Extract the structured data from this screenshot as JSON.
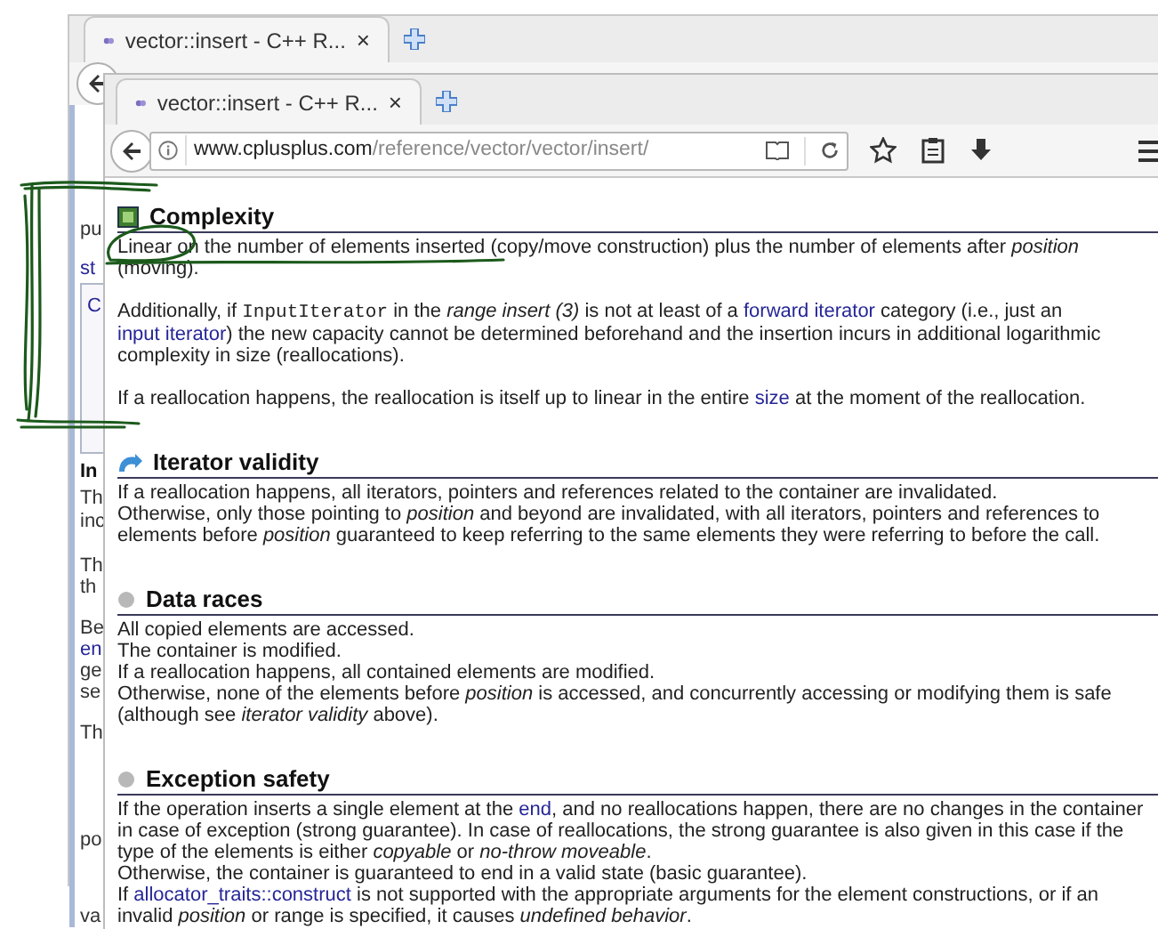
{
  "back_window": {
    "tab": {
      "title": "vector::insert - C++ R...",
      "close": "×",
      "selected": true
    },
    "fragments": [
      {
        "kind": "text",
        "text": "pu"
      },
      {
        "kind": "link",
        "text": "st"
      },
      {
        "kind": "box",
        "text": "C"
      },
      {
        "kind": "bold",
        "text": "In"
      },
      {
        "kind": "text",
        "text": "Th"
      },
      {
        "kind": "text",
        "text": "inc"
      },
      {
        "kind": "text",
        "text": "Th"
      },
      {
        "kind": "text",
        "text": "th"
      },
      {
        "kind": "text",
        "text": "Be"
      },
      {
        "kind": "link",
        "text": "en"
      },
      {
        "kind": "text",
        "text": "ge"
      },
      {
        "kind": "text",
        "text": "se"
      },
      {
        "kind": "text",
        "text": "Th"
      },
      {
        "kind": "text",
        "text": "po"
      },
      {
        "kind": "text",
        "text": "va"
      }
    ]
  },
  "front_window": {
    "tab": {
      "title": "vector::insert - C++ R...",
      "close": "×",
      "selected": true
    },
    "url": {
      "domain": "www.cplusplus.com",
      "path": "/reference/vector/vector/insert/"
    },
    "sections": [
      {
        "title": "Complexity",
        "blocks": [
          [
            [
              {
                "kind": "plain",
                "text": "Linear on the number of elements inserted (copy/move construction) plus the number of elements after "
              },
              {
                "kind": "italic",
                "text": "position"
              },
              {
                "kind": "plain",
                "text": " (moving)."
              }
            ]
          ],
          [
            [
              {
                "kind": "plain",
                "text": "Additionally, if "
              },
              {
                "kind": "code",
                "text": "InputIterator"
              },
              {
                "kind": "plain",
                "text": " in the "
              },
              {
                "kind": "italic",
                "text": "range insert (3)"
              },
              {
                "kind": "plain",
                "text": " is not at least of a "
              },
              {
                "kind": "link",
                "text": "forward iterator"
              },
              {
                "kind": "plain",
                "text": " category (i.e., just an "
              },
              {
                "kind": "link",
                "text": "input iterator"
              },
              {
                "kind": "plain",
                "text": ") the new capacity cannot be determined beforehand and the insertion incurs in additional logarithmic complexity in size (reallocations)."
              }
            ]
          ],
          [
            [
              {
                "kind": "plain",
                "text": "If a reallocation happens, the reallocation is itself up to linear in the entire "
              },
              {
                "kind": "link",
                "text": "size"
              },
              {
                "kind": "plain",
                "text": " at the moment of the reallocation."
              }
            ]
          ]
        ]
      },
      {
        "title": "Iterator validity",
        "blocks": [
          [
            [
              {
                "kind": "plain",
                "text": "If a reallocation happens, all iterators, pointers and references related to the container are invalidated."
              }
            ],
            [
              {
                "kind": "plain",
                "text": "Otherwise, only those pointing to "
              },
              {
                "kind": "italic",
                "text": "position"
              },
              {
                "kind": "plain",
                "text": " and beyond are invalidated, with all iterators, pointers and references to elements before "
              },
              {
                "kind": "italic",
                "text": "position"
              },
              {
                "kind": "plain",
                "text": " guaranteed to keep referring to the same elements they were referring to before the call."
              }
            ]
          ]
        ]
      },
      {
        "title": "Data races",
        "blocks": [
          [
            [
              {
                "kind": "plain",
                "text": "All copied elements are accessed."
              }
            ],
            [
              {
                "kind": "plain",
                "text": "The container is modified."
              }
            ],
            [
              {
                "kind": "plain",
                "text": "If a reallocation happens, all contained elements are modified."
              }
            ],
            [
              {
                "kind": "plain",
                "text": "Otherwise, none of the elements before "
              },
              {
                "kind": "italic",
                "text": "position"
              },
              {
                "kind": "plain",
                "text": " is accessed, and concurrently accessing or modifying them is safe (although see "
              },
              {
                "kind": "italic",
                "text": "iterator validity"
              },
              {
                "kind": "plain",
                "text": " above)."
              }
            ]
          ]
        ]
      },
      {
        "title": "Exception safety",
        "blocks": [
          [
            [
              {
                "kind": "plain",
                "text": "If the operation inserts a single element at the "
              },
              {
                "kind": "link",
                "text": "end"
              },
              {
                "kind": "plain",
                "text": ", and no reallocations happen, there are no changes in the container in case of exception (strong guarantee). In case of reallocations, the strong guarantee is also given in this case if the type of the elements is either "
              },
              {
                "kind": "italic",
                "text": "copyable"
              },
              {
                "kind": "plain",
                "text": " or "
              },
              {
                "kind": "italic",
                "text": "no-throw moveable"
              },
              {
                "kind": "plain",
                "text": "."
              }
            ],
            [
              {
                "kind": "plain",
                "text": "Otherwise, the container is guaranteed to end in a valid state (basic guarantee)."
              }
            ],
            [
              {
                "kind": "plain",
                "text": "If "
              },
              {
                "kind": "link",
                "text": "allocator_traits::construct"
              },
              {
                "kind": "plain",
                "text": " is not supported with the appropriate arguments for the element constructions, or if an invalid "
              },
              {
                "kind": "italic",
                "text": "position"
              },
              {
                "kind": "plain",
                "text": " or range is specified, it causes "
              },
              {
                "kind": "italic",
                "text": "undefined behavior"
              },
              {
                "kind": "plain",
                "text": "."
              }
            ]
          ]
        ]
      }
    ]
  }
}
